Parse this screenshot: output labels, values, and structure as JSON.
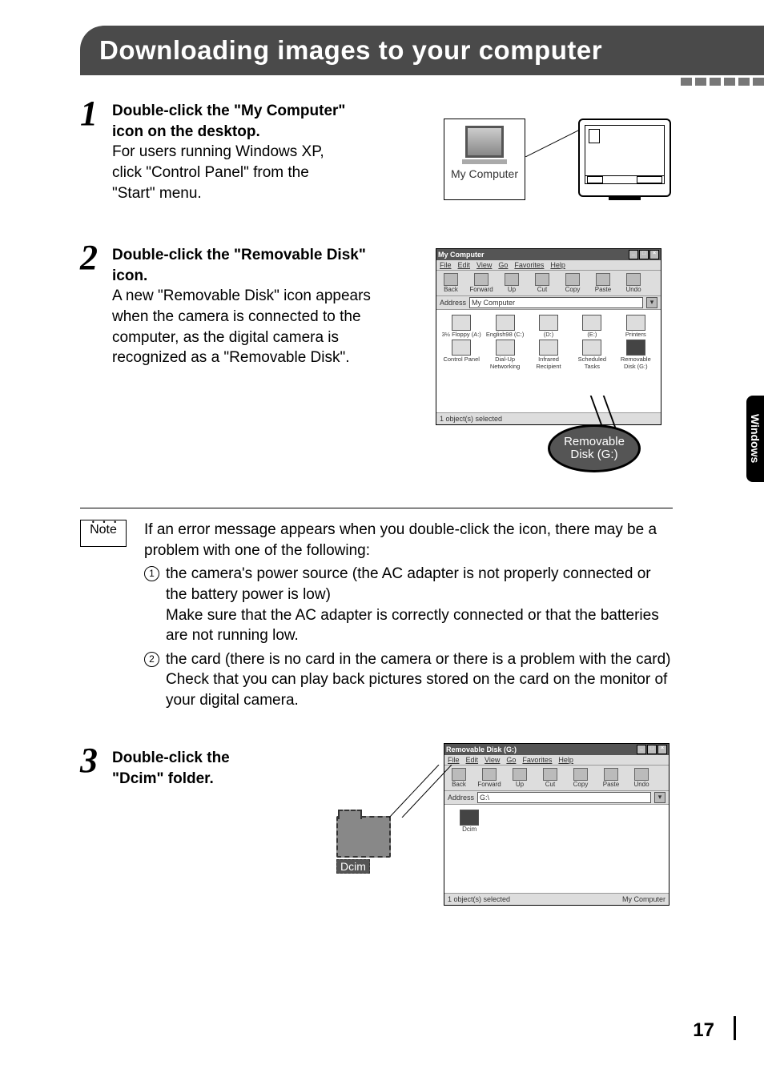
{
  "titlebar": "Downloading images to your computer",
  "side_tab": "Windows",
  "page_number": "17",
  "step1": {
    "num": "1",
    "bold": "Double-click the \"My Computer\" icon on the desktop.",
    "body": "For users running Windows XP, click \"Control Panel\" from the \"Start\" menu.",
    "icon_label": "My Computer"
  },
  "step2": {
    "num": "2",
    "bold": "Double-click the \"Removable Disk\" icon.",
    "body": "A new \"Removable Disk\" icon appears when the camera is connected to the computer, as the digital camera is recognized as a \"Removable Disk\".",
    "callout_line1": "Removable",
    "callout_line2": "Disk (G:)"
  },
  "win_mycomputer": {
    "title": "My Computer",
    "menu": [
      "File",
      "Edit",
      "View",
      "Go",
      "Favorites",
      "Help"
    ],
    "toolbar": [
      {
        "label": "Back"
      },
      {
        "label": "Forward"
      },
      {
        "label": "Up"
      },
      {
        "label": "Cut"
      },
      {
        "label": "Copy"
      },
      {
        "label": "Paste"
      },
      {
        "label": "Undo"
      }
    ],
    "address_label": "Address",
    "address_value": "My Computer",
    "icons": [
      {
        "label": "3½ Floppy (A:)"
      },
      {
        "label": "English98 (C:)"
      },
      {
        "label": "(D:)"
      },
      {
        "label": "(E:)"
      },
      {
        "label": "Printers"
      },
      {
        "label": "Control Panel"
      },
      {
        "label": "Dial-Up Networking"
      },
      {
        "label": "Infrared Recipient"
      },
      {
        "label": "Scheduled Tasks"
      },
      {
        "label": "Removable Disk (G:)",
        "highlight": true
      }
    ],
    "status": "1 object(s) selected"
  },
  "note": {
    "label": "Note",
    "intro": "If an error message appears when you double-click the icon, there may be a problem with one of the following:",
    "item1_num": "1",
    "item1_a": "the camera's power source (the AC adapter is not properly connected or the battery power is low)",
    "item1_b": "Make sure that the AC adapter is correctly connected or that the batteries are not running low.",
    "item2_num": "2",
    "item2_a": "the card (there is no card in the camera or there is a problem with the card)",
    "item2_b": "Check that you can play back pictures stored on the card on the monitor of your digital camera."
  },
  "step3": {
    "num": "3",
    "bold": "Double-click the \"Dcim\" folder.",
    "dcim_label": "Dcim"
  },
  "win_removable": {
    "title": "Removable Disk (G:)",
    "menu": [
      "File",
      "Edit",
      "View",
      "Go",
      "Favorites",
      "Help"
    ],
    "toolbar": [
      {
        "label": "Back"
      },
      {
        "label": "Forward"
      },
      {
        "label": "Up"
      },
      {
        "label": "Cut"
      },
      {
        "label": "Copy"
      },
      {
        "label": "Paste"
      },
      {
        "label": "Undo"
      }
    ],
    "address_label": "Address",
    "address_value": "G:\\",
    "folder_label": "Dcim",
    "status": "1 object(s) selected",
    "status_right": "My Computer"
  }
}
